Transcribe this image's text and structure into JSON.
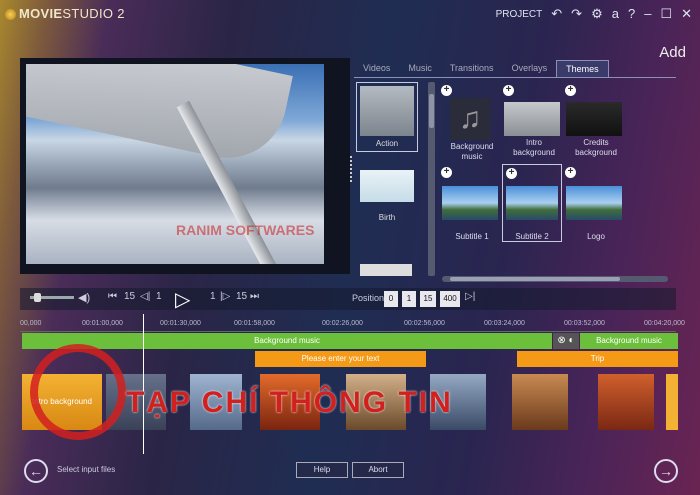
{
  "app": {
    "title_main": "MOVIE",
    "title_rest": "STUDIO 2"
  },
  "titlebar": {
    "project": "PROJECT",
    "undo": "↶",
    "redo": "↷",
    "settings": "⚙",
    "account": "a",
    "help": "?",
    "minimize": "–",
    "maximize": "☐",
    "close": "✕"
  },
  "library": {
    "heading": "Add",
    "tabs": [
      "Videos",
      "Music",
      "Transitions",
      "Overlays",
      "Themes"
    ],
    "active_tab": "Themes",
    "left_items": [
      "Action",
      "Birth"
    ],
    "grid": [
      {
        "label": "Background music"
      },
      {
        "label": "Intro background"
      },
      {
        "label": "Credits background"
      },
      {
        "label": "Subtitle 1"
      },
      {
        "label": "Subtitle 2"
      },
      {
        "label": "Logo"
      }
    ]
  },
  "transport": {
    "skip_back": "15",
    "frame_back": "1",
    "frame_fwd": "1",
    "skip_fwd": "15",
    "position_label": "Position:",
    "position": [
      "0",
      "1",
      "15",
      "400"
    ]
  },
  "timeline": {
    "ticks": [
      "00,000",
      "00:01:00,000",
      "00:01:30,000",
      "00:01:58,000",
      "00:02:26,000",
      "00:02:56,000",
      "00:03:24,000",
      "00:03:52,000",
      "00:04:20,000"
    ],
    "music1": "Background music",
    "music2": "Background music",
    "text1": "Please enter your text",
    "text2": "Trip",
    "first_clip": "Intro background"
  },
  "watermarks": {
    "big": "TẠP CHÍ THÔNG TIN",
    "image": "RANIM SOFTWARES"
  },
  "footer": {
    "hint": "Select input files",
    "help": "Help",
    "abort": "Abort"
  },
  "colors": {
    "music": "#6cbf3a",
    "text_track": "#f59a16",
    "accent": "#d2201e"
  }
}
